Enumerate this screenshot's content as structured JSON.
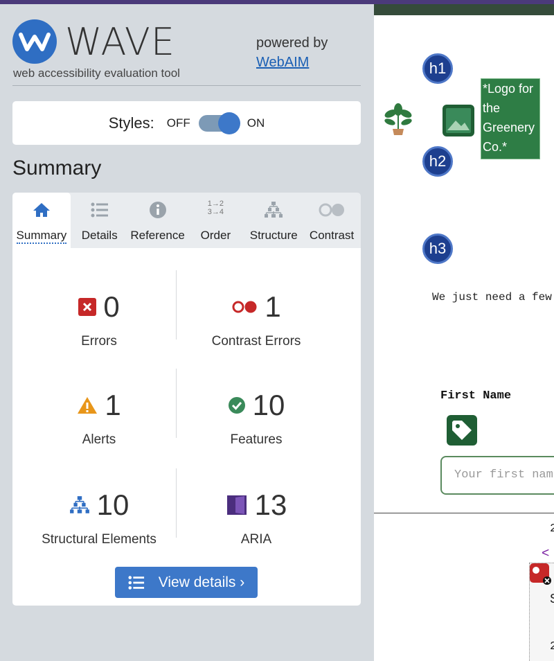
{
  "app": {
    "name": "WAVE",
    "subtitle": "web accessibility evaluation tool",
    "powered_by": "powered by",
    "powered_link": "WebAIM"
  },
  "styles_toggle": {
    "label": "Styles:",
    "off": "OFF",
    "on": "ON",
    "state": "on"
  },
  "summary_heading": "Summary",
  "tabs": [
    {
      "label": "Summary",
      "icon": "home-icon",
      "active": true
    },
    {
      "label": "Details",
      "icon": "list-icon"
    },
    {
      "label": "Reference",
      "icon": "info-icon"
    },
    {
      "label": "Order",
      "icon": "order-icon",
      "glyph": "1→2 3→4"
    },
    {
      "label": "Structure",
      "icon": "structure-icon"
    },
    {
      "label": "Contrast",
      "icon": "contrast-icon"
    }
  ],
  "stats": {
    "errors": {
      "value": "0",
      "label": "Errors"
    },
    "contrast": {
      "value": "1",
      "label": "Contrast Errors"
    },
    "alerts": {
      "value": "1",
      "label": "Alerts"
    },
    "features": {
      "value": "10",
      "label": "Features"
    },
    "structural": {
      "value": "10",
      "label": "Structural Elements"
    },
    "aria": {
      "value": "13",
      "label": "ARIA"
    }
  },
  "view_details": "View details ›",
  "page_preview": {
    "h1": "h1",
    "h2": "h2",
    "h3": "h3",
    "logo_alt": "*Logo for the Greenery Co.*",
    "intro": "We just need a few",
    "first_name_label": "First Name",
    "first_name_placeholder": "Your first name",
    "code_digit_1": "2",
    "code_tag": "<",
    "code_s": "S",
    "code_digit_2": "2"
  },
  "colors": {
    "accent": "#3d78c9",
    "sidebar_bg": "#d5dadf",
    "error_red": "#c62828",
    "alert_orange": "#e8961a",
    "feature_green": "#3a8a5a",
    "aria_purple": "#4b2e7e"
  }
}
